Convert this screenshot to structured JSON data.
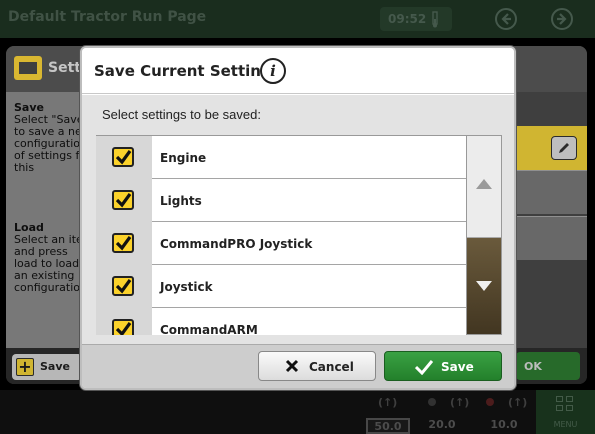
{
  "topbar": {
    "title": "Default Tractor Run Page",
    "clock": "09:52"
  },
  "background_page": {
    "header_title": "Settings",
    "save_section": {
      "title": "Save",
      "text": "Select \"Save\" to save a new configuration of settings for this application."
    },
    "load_section": {
      "title": "Load",
      "text": "Select an item and press load to load an existing configuration."
    },
    "footer_save_label": "Save",
    "ok_label": "OK"
  },
  "bottombar": {
    "gauges": [
      "50.0",
      "20.0",
      "10.0"
    ],
    "menu_label": "MENU"
  },
  "dialog": {
    "title": "Save Current Settings",
    "info_symbol": "i",
    "subtitle": "Select settings to be saved:",
    "items": [
      {
        "label": "Engine",
        "checked": true
      },
      {
        "label": "Lights",
        "checked": true
      },
      {
        "label": "CommandPRO Joystick",
        "checked": true
      },
      {
        "label": "Joystick",
        "checked": true
      },
      {
        "label": "CommandARM",
        "checked": true
      }
    ],
    "cancel_label": "Cancel",
    "save_label": "Save"
  },
  "colors": {
    "checkbox_fill": "#fbd22b",
    "save_button": "#2e8b35",
    "topbar_bg": "#1f3524",
    "highlight_row": "#f5d53a"
  }
}
